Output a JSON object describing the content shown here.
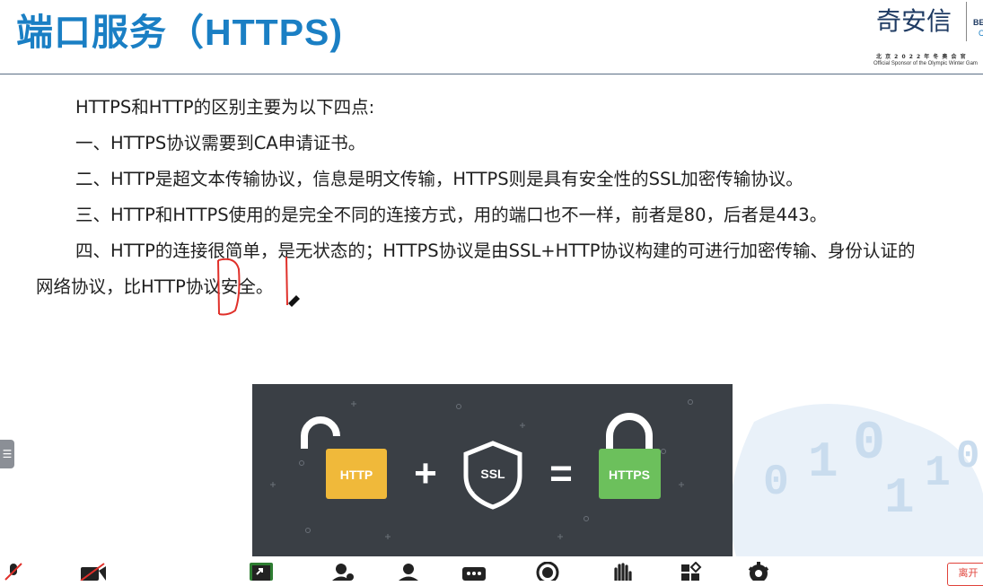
{
  "header": {
    "title": "端口服务（HTTPS)",
    "logo_text": "奇安信",
    "logo_cut_text": "BE",
    "logo_cut_text2": "C",
    "logo_sub1": "北 京 2 0 2 2 年 冬 奥 会 官",
    "logo_sub2": "Official Sponsor of the Olympic Winter Gam"
  },
  "content": {
    "paragraphs": [
      "HTTPS和HTTP的区别主要为以下四点:",
      "一、HTTPS协议需要到CA申请证书。",
      "二、HTTP是超文本传输协议，信息是明文传输，HTTPS则是具有安全性的SSL加密传输协议。",
      "三、HTTP和HTTPS使用的是完全不同的连接方式，用的端口也不一样，前者是80，后者是443。",
      "四、HTTP的连接很简单，是无状态的；HTTPS协议是由SSL+HTTP协议构建的可进行加密传输、身份认证的网络协议，比HTTP协议安全。"
    ]
  },
  "banner": {
    "http_label": "HTTP",
    "ssl_label": "SSL",
    "https_label": "HTTPS",
    "plus": "+",
    "equals": "="
  },
  "background_digits": [
    "0",
    "1",
    "0",
    "1",
    "1",
    "0"
  ],
  "left_tab_glyph": "☰",
  "toolbar": {
    "end_label": "离开",
    "icons": [
      "mic-muted-icon",
      "camera-off-icon",
      "share-screen-icon",
      "participants-icon",
      "chat-icon",
      "more-icon",
      "record-icon",
      "raise-hand-icon",
      "apps-icon",
      "settings-icon"
    ]
  },
  "colors": {
    "title": "#1a7fc4",
    "banner_bg": "#3a3f45",
    "http_lock": "#f0b93a",
    "https_lock": "#6cc05c",
    "annotation_red": "#e0302a"
  }
}
